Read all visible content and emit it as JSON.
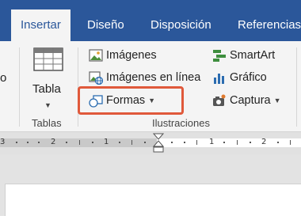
{
  "tabs": {
    "insertar": "Insertar",
    "diseno": "Diseño",
    "disposicion": "Disposición",
    "referencias": "Referencias"
  },
  "ribbon": {
    "edge_fragment": "o",
    "tabla": {
      "label": "Tabla",
      "group": "Tablas"
    },
    "ilustraciones": {
      "group": "Ilustraciones",
      "imagenes": "Imágenes",
      "imagenes_linea": "Imágenes en línea",
      "formas": "Formas",
      "smartart": "SmartArt",
      "grafico": "Gráfico",
      "captura": "Captura"
    }
  },
  "ruler": {
    "numbers": [
      "3",
      "2",
      "1",
      "1",
      "2",
      "3"
    ]
  },
  "colors": {
    "tab_bar": "#2b579a",
    "highlight": "#e0593b"
  }
}
